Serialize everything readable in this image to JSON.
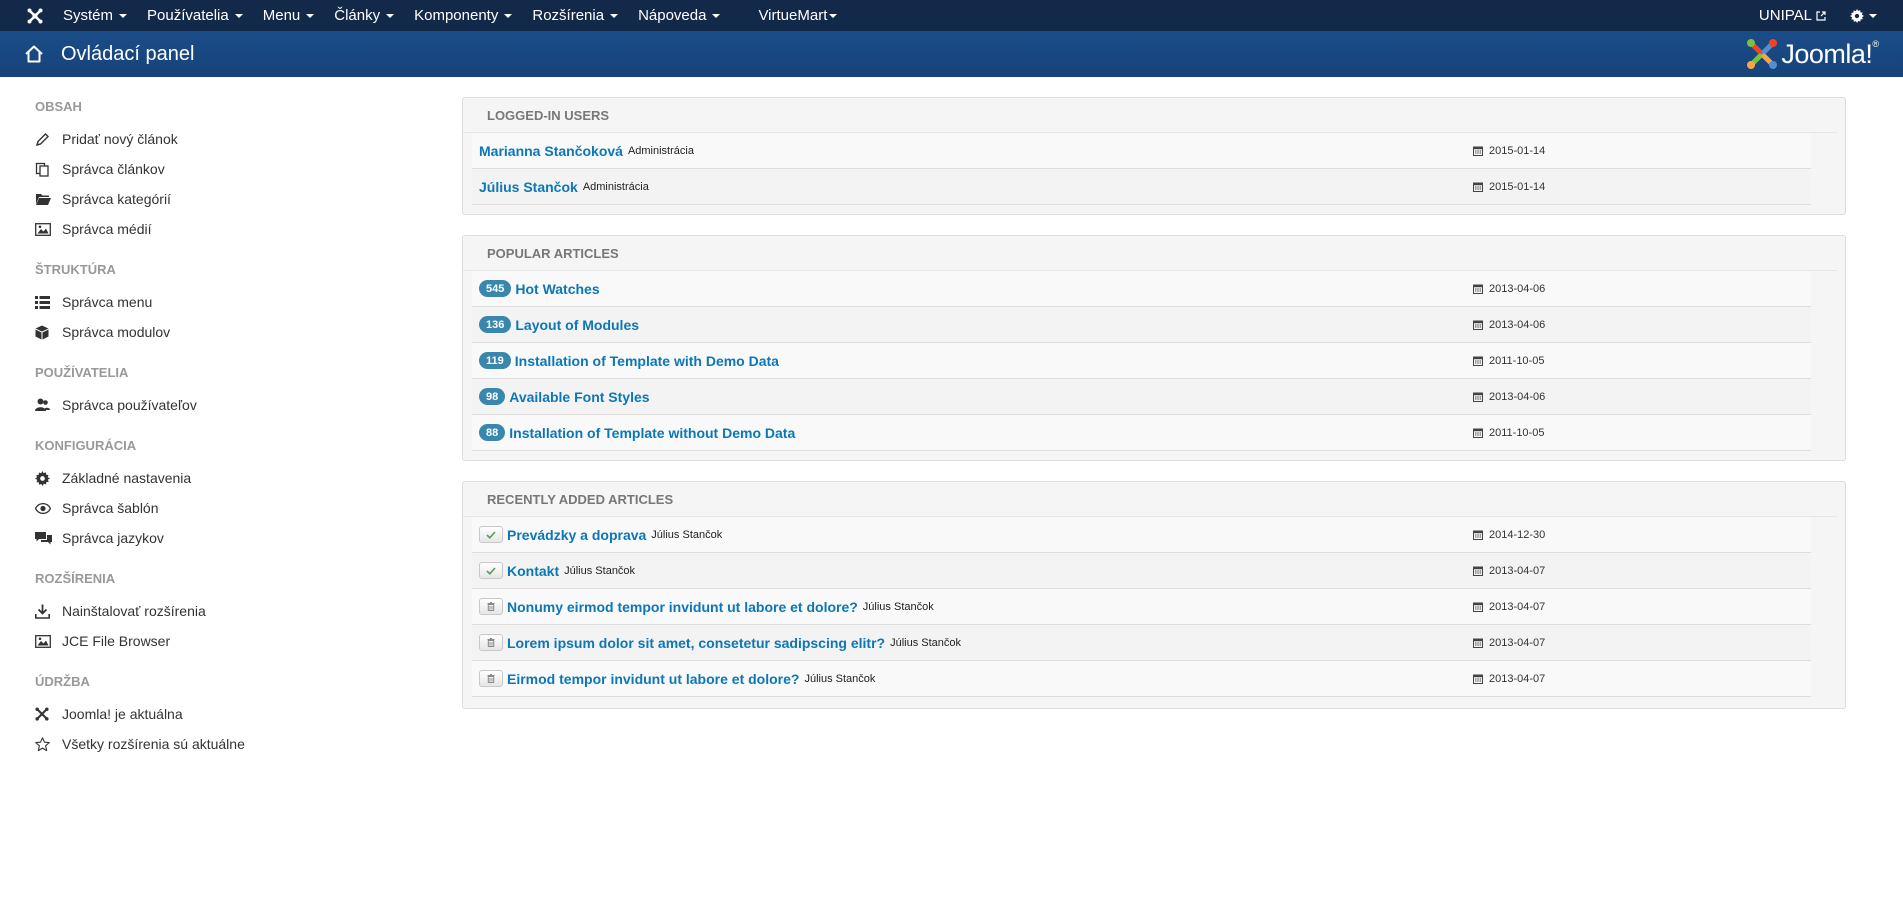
{
  "navbar": {
    "menu": [
      {
        "label": "Systém"
      },
      {
        "label": "Používatelia"
      },
      {
        "label": "Menu"
      },
      {
        "label": "Články"
      },
      {
        "label": "Komponenty"
      },
      {
        "label": "Rozšírenia"
      },
      {
        "label": "Nápoveda"
      }
    ],
    "virtuemart": "VirtueMart",
    "user": "UNIPAL"
  },
  "header": {
    "title": "Ovládací panel",
    "brand": "Joomla!",
    "brand_reg": "®"
  },
  "sidebar": {
    "sections": [
      {
        "heading": "OBSAH",
        "items": [
          {
            "label": "Pridať nový článok",
            "icon": "pencil-icon"
          },
          {
            "label": "Správca článkov",
            "icon": "copy-icon"
          },
          {
            "label": "Správca kategórií",
            "icon": "folder-icon"
          },
          {
            "label": "Správca médií",
            "icon": "image-icon"
          }
        ]
      },
      {
        "heading": "ŠTRUKTÚRA",
        "items": [
          {
            "label": "Správca menu",
            "icon": "list-icon"
          },
          {
            "label": "Správca modulov",
            "icon": "cube-icon"
          }
        ]
      },
      {
        "heading": "POUŽÍVATELIA",
        "items": [
          {
            "label": "Správca používateľov",
            "icon": "users-icon"
          }
        ]
      },
      {
        "heading": "KONFIGURÁCIA",
        "items": [
          {
            "label": "Základné nastavenia",
            "icon": "gear-icon"
          },
          {
            "label": "Správca šablón",
            "icon": "eye-icon"
          },
          {
            "label": "Správca jazykov",
            "icon": "comments-icon"
          }
        ]
      },
      {
        "heading": "ROZŠÍRENIA",
        "items": [
          {
            "label": "Nainštalovať rozšírenia",
            "icon": "download-icon"
          },
          {
            "label": "JCE File Browser",
            "icon": "image-icon"
          }
        ]
      },
      {
        "heading": "ÚDRŽBA",
        "items": [
          {
            "label": "Joomla! je aktuálna",
            "icon": "joomla-icon"
          },
          {
            "label": "Všetky rozšírenia sú aktuálne",
            "icon": "star-icon"
          }
        ]
      }
    ]
  },
  "logged_in": {
    "title": "LOGGED-IN USERS",
    "rows": [
      {
        "name": "Marianna Stančoková",
        "role": "Administrácia",
        "date": "2015-01-14"
      },
      {
        "name": "Július Stančok",
        "role": "Administrácia",
        "date": "2015-01-14"
      }
    ]
  },
  "popular": {
    "title": "POPULAR ARTICLES",
    "rows": [
      {
        "hits": "545",
        "title": "Hot Watches",
        "date": "2013-04-06"
      },
      {
        "hits": "136",
        "title": "Layout of Modules",
        "date": "2013-04-06"
      },
      {
        "hits": "119",
        "title": "Installation of Template with Demo Data",
        "date": "2011-10-05"
      },
      {
        "hits": "98",
        "title": "Available Font Styles",
        "date": "2013-04-06"
      },
      {
        "hits": "88",
        "title": "Installation of Template without Demo Data",
        "date": "2011-10-05"
      }
    ]
  },
  "recent": {
    "title": "RECENTLY ADDED ARTICLES",
    "rows": [
      {
        "state": "published",
        "title": "Prevádzky a doprava",
        "author": "Július Stančok",
        "date": "2014-12-30"
      },
      {
        "state": "published",
        "title": "Kontakt",
        "author": "Július Stančok",
        "date": "2013-04-07"
      },
      {
        "state": "trashed",
        "title": "Nonumy eirmod tempor invidunt ut labore et dolore?",
        "author": "Július Stančok",
        "date": "2013-04-07"
      },
      {
        "state": "trashed",
        "title": "Lorem ipsum dolor sit amet, consetetur sadipscing elitr?",
        "author": "Július Stančok",
        "date": "2013-04-07"
      },
      {
        "state": "trashed",
        "title": "Eirmod tempor invidunt ut labore et dolore?",
        "author": "Július Stančok",
        "date": "2013-04-07"
      }
    ]
  }
}
